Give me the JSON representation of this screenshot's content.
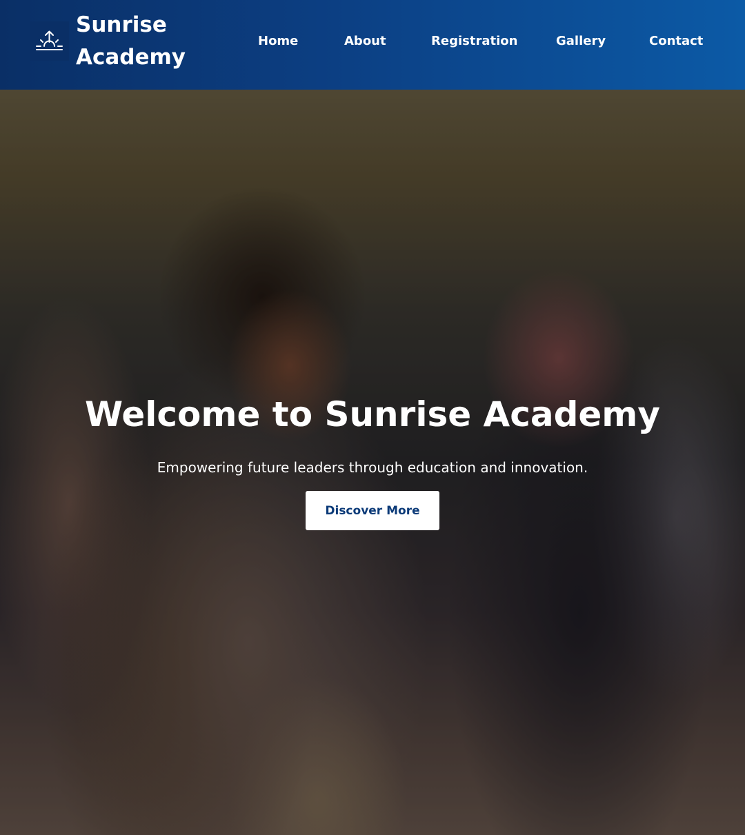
{
  "brand": {
    "name_line1": "Sunrise",
    "name_line2": "Academy",
    "logo_icon": "sunrise-icon"
  },
  "nav": {
    "items": [
      {
        "label": "Home"
      },
      {
        "label": "About"
      },
      {
        "label": "Registration"
      },
      {
        "label": "Gallery"
      },
      {
        "label": "Contact"
      }
    ]
  },
  "hero": {
    "title": "Welcome to Sunrise Academy",
    "subtitle": "Empowering future leaders through education and innovation.",
    "cta_label": "Discover More"
  },
  "colors": {
    "header_start": "#0a2f66",
    "header_end": "#0c5aa6",
    "cta_text": "#0b3a78",
    "text": "#ffffff"
  }
}
